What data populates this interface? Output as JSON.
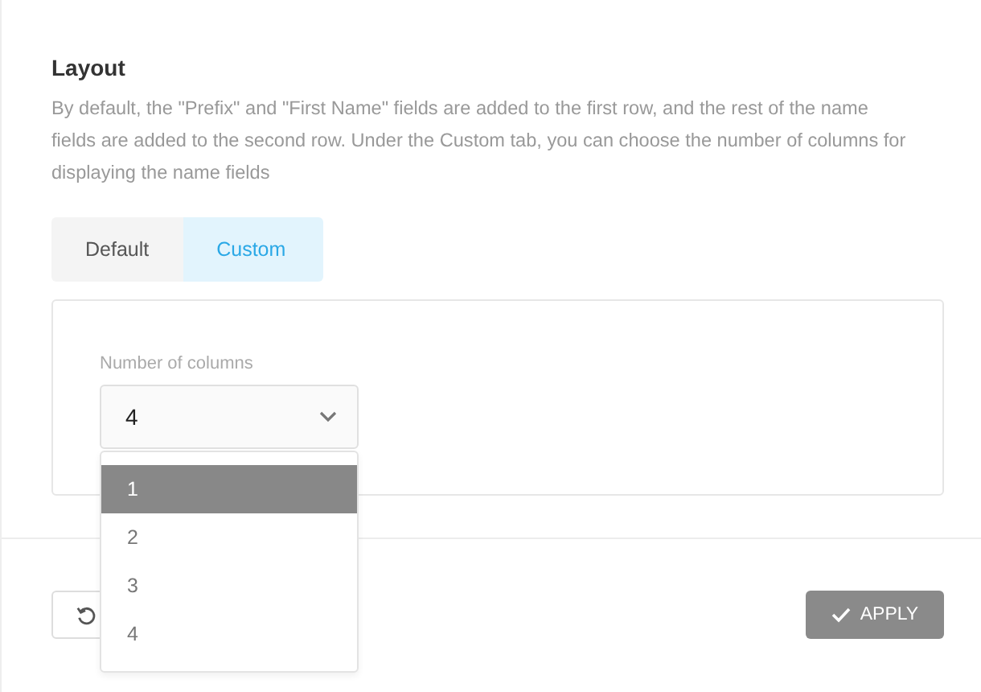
{
  "section": {
    "title": "Layout",
    "description": "By default, the \"Prefix\" and \"First Name\" fields are added to the first row, and the rest of the name fields are added to the second row. Under the Custom tab, you can choose the number of columns for displaying the name fields"
  },
  "tabs": [
    {
      "label": "Default",
      "selected": false
    },
    {
      "label": "Custom",
      "selected": true
    }
  ],
  "columns_select": {
    "label": "Number of columns",
    "value": "4",
    "expanded": true,
    "options": [
      {
        "label": "1",
        "highlighted": true
      },
      {
        "label": "2",
        "highlighted": false
      },
      {
        "label": "3",
        "highlighted": false
      },
      {
        "label": "4",
        "highlighted": false
      }
    ]
  },
  "footer": {
    "apply_button": "APPLY"
  }
}
